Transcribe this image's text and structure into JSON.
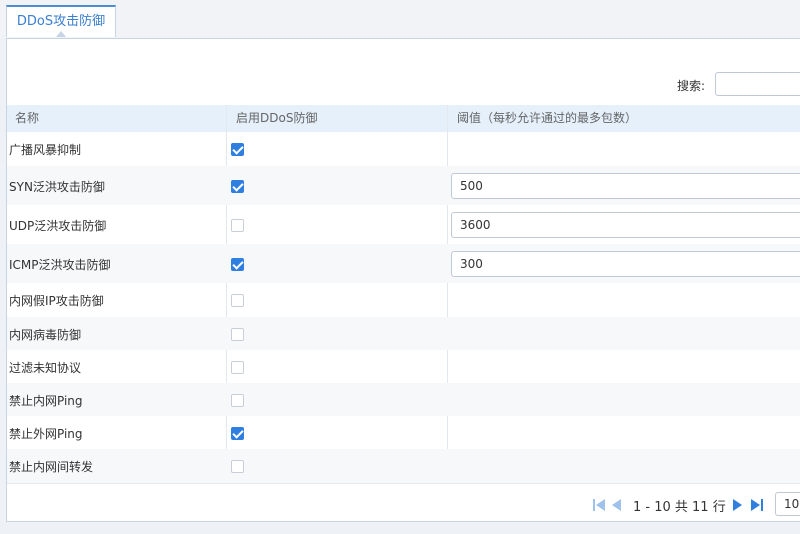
{
  "tab": {
    "label": "DDoS攻击防御"
  },
  "search": {
    "label": "搜索:",
    "value": ""
  },
  "table": {
    "headers": [
      "名称",
      "启用DDoS防御",
      "阈值（每秒允许通过的最多包数）"
    ],
    "rows": [
      {
        "name": "广播风暴抑制",
        "enabled": true,
        "threshold": null
      },
      {
        "name": "SYN泛洪攻击防御",
        "enabled": true,
        "threshold": "500"
      },
      {
        "name": "UDP泛洪攻击防御",
        "enabled": false,
        "threshold": "3600"
      },
      {
        "name": "ICMP泛洪攻击防御",
        "enabled": true,
        "threshold": "300"
      },
      {
        "name": "内网假IP攻击防御",
        "enabled": false,
        "threshold": null
      },
      {
        "name": "内网病毒防御",
        "enabled": false,
        "threshold": null
      },
      {
        "name": "过滤未知协议",
        "enabled": false,
        "threshold": null
      },
      {
        "name": "禁止内网Ping",
        "enabled": false,
        "threshold": null
      },
      {
        "name": "禁止外网Ping",
        "enabled": true,
        "threshold": null
      },
      {
        "name": "禁止内网间转发",
        "enabled": false,
        "threshold": null
      }
    ]
  },
  "pager": {
    "summary": "1 - 10 共 11 行",
    "page_size": "10"
  },
  "colors": {
    "accent": "#2f7fe0",
    "header_bg": "#e5f0fb",
    "border": "#c6d4e6"
  },
  "icons": [
    "first-page-icon",
    "prev-page-icon",
    "next-page-icon",
    "last-page-icon"
  ]
}
